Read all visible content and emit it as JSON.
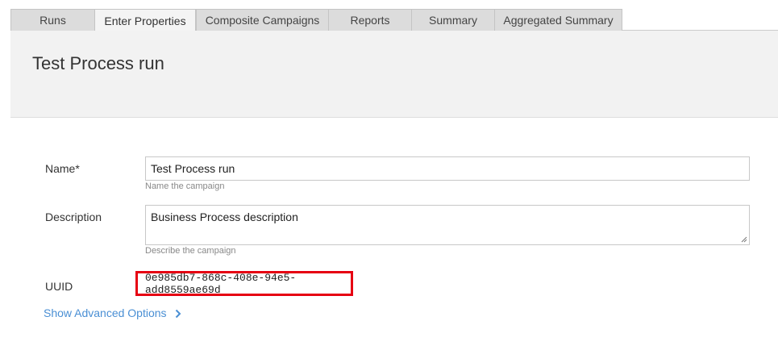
{
  "tabs": [
    {
      "label": "Runs",
      "active": false
    },
    {
      "label": "Enter Properties",
      "active": true
    },
    {
      "label": "Composite Campaigns",
      "active": false
    },
    {
      "label": "Reports",
      "active": false
    },
    {
      "label": "Summary",
      "active": false
    },
    {
      "label": "Aggregated Summary",
      "active": false
    }
  ],
  "header": {
    "title": "Test Process run"
  },
  "form": {
    "name": {
      "label": "Name*",
      "value": "Test Process run",
      "hint": "Name the campaign"
    },
    "description": {
      "label": "Description",
      "value": "Business Process description",
      "hint": "Describe the campaign"
    },
    "uuid": {
      "label": "UUID",
      "value": "0e985db7-868c-408e-94e5-add8559ae69d"
    },
    "advanced_link": "Show Advanced Options"
  },
  "colors": {
    "highlight": "#e60012",
    "link": "#4a8fd4"
  }
}
